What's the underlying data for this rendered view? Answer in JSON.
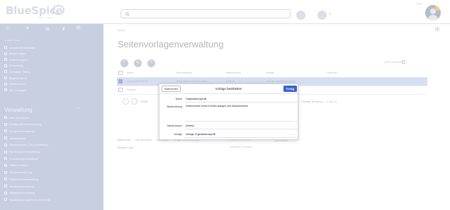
{
  "topbar": {
    "logo_text": "BlueSpice",
    "logo_sub": "free pro nutzen",
    "search_placeholder": "",
    "user_label": "Sysop"
  },
  "sidebar": {
    "section_label": "Neueste Aktivität",
    "items": [
      {
        "label": "Erweiterte Dateiliste",
        "icon": "list-icon"
      },
      {
        "label": "Bewertungen",
        "icon": "star-icon"
      },
      {
        "label": "Empfehlungen",
        "icon": "thumb-icon"
      },
      {
        "label": "Erinnerung",
        "icon": "flag-icon"
      },
      {
        "label": "Verwaiste Seiten",
        "icon": "page-icon"
      },
      {
        "label": "Begutachtung",
        "icon": "eye-icon"
      },
      {
        "label": "WikiExplorer",
        "icon": "compass-icon"
      },
      {
        "label": "Alle Vorlagen",
        "icon": "template-icon"
      }
    ],
    "admin_heading": "Verwaltung",
    "admin_items": [
      {
        "label": "Über BlueSpice",
        "icon": "info-icon"
      },
      {
        "label": "Konfigurationsverwaltung",
        "icon": "wrench-icon"
      },
      {
        "label": "Gruppenverwaltung",
        "icon": "group-icon"
      },
      {
        "label": "Interwikilinks",
        "icon": "link-icon"
      },
      {
        "label": "Namensraum-CSS-Verwaltung",
        "icon": "css-icon"
      },
      {
        "label": "Namensraumverwaltung",
        "icon": "namespace-icon"
      },
      {
        "label": "Zuweisungsverwaltung",
        "icon": "assign-icon"
      },
      {
        "label": "Seitenvorlagen",
        "icon": "template-icon"
      },
      {
        "label": "Rechteverwaltung",
        "icon": "key-icon"
      },
      {
        "label": "Datenschutzverwaltung",
        "icon": "shield-icon"
      },
      {
        "label": "Benutzerverwaltung",
        "icon": "user-icon"
      },
      {
        "label": "Kategorieverwaltung",
        "icon": "tag-icon"
      },
      {
        "label": "Qualitätsmanagement Übersicht",
        "icon": "check-icon"
      }
    ]
  },
  "main": {
    "breadcrumb": "Spezial",
    "title": "Seitenvorlagenverwaltung",
    "toolbar_icons": [
      "add-icon",
      "edit-icon",
      "delete-icon"
    ],
    "filter_label": "Zeilen auswählen",
    "table": {
      "columns": [
        "",
        "Name",
        "Beschreibung",
        "Namensraum",
        "Vorlage",
        "Vorschau"
      ],
      "rows": [
        {
          "selected": true,
          "cells": [
            "Organisationsprofil",
            "Unternehmen eines Kunden",
            "(Seiten)",
            "Vorlage Organisationsprofil",
            ""
          ]
        },
        {
          "selected": false,
          "cells": [
            "Protokoll",
            "",
            "",
            "Vorlage Protokoll",
            ""
          ]
        }
      ]
    },
    "pager_label": "Seite",
    "pager_info": "Vorlage (Eintrag 1 - 2 von 2)",
    "footer_links": [
      "Datenschutz",
      "Über BlueSpice",
      "Impressum",
      "Vorlage Verlauf anzeigen"
    ],
    "footer_category": "Kategorie:Liste",
    "footer_mid": "Dokument zuweisen",
    "footer_mid2": "Ansichten verwalten",
    "footer_right": "Abschreiben"
  },
  "dialog": {
    "cancel_label": "Abbrechen",
    "title": "Vorlage bearbeiten",
    "done_label": "Fertig",
    "fields": [
      {
        "label": "Name",
        "value": "Organisationsprofil"
      },
      {
        "label": "Beschreibung",
        "value": "Unternehmen eines Kunden anlegen und dokumentieren"
      },
      {
        "label": "Namensraum",
        "value": "(Seiten)"
      },
      {
        "label": "Vorlage",
        "value": "Vorlage Organisationsprofil"
      }
    ]
  },
  "colors": {
    "sidebar_bg": "#c8cfe0",
    "accent": "#3b66cc",
    "selected_row": "#d6def2"
  }
}
